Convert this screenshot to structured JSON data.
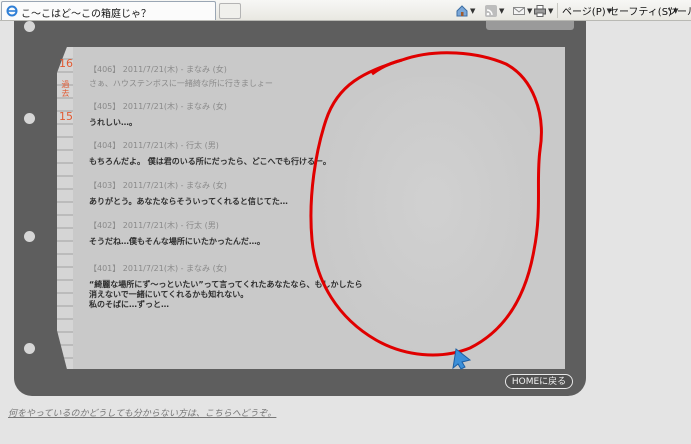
{
  "browser": {
    "tab_title": "こ〜こはど〜この箱庭じゃ？",
    "toolbar": {
      "page_label": "ページ(P)",
      "safety_label": "セーフティ(S)",
      "tools_label": "ツール"
    }
  },
  "side": {
    "num_top": "16",
    "kanji": "過去",
    "num_bottom": "15"
  },
  "entries": [
    {
      "meta": "【406】 2011/7/21(木)  - まなみ (女)",
      "msg": "さぁ、ハウステンボスに一緒綺な所に行きましょー"
    },
    {
      "meta": "【405】 2011/7/21(木)  - まなみ (女)",
      "msg": "うれしい…。"
    },
    {
      "meta": "【404】 2011/7/21(木)  - 行太 (男)",
      "msg": "もちろんだよ。  僕は君のいる所にだったら、どこへでも行けるー。"
    },
    {
      "meta": "【403】 2011/7/21(木)  - まなみ (女)",
      "msg": "ありがとう。あなたならそういってくれると信じてた…"
    },
    {
      "meta": "【402】 2011/7/21(木)  - 行太 (男)",
      "msg": "そうだね…僕もそんな場所にいたかったんだ…。"
    },
    {
      "meta": "【401】 2011/7/21(木)  - まなみ (女)",
      "msg_lines": [
        "“綺麗な場所にず〜っといたい”って言ってくれたあなたなら、もしかしたら",
        "消えないで一緒にいてくれるかも知れない。",
        "私のそばに…ずっと…"
      ]
    }
  ],
  "home_button": "HOMEに戻る",
  "help_link": "何をやっているのかどうしても分からない方は、こちらへどうぞ。",
  "colors": {
    "binder": "#5e5e5e",
    "paper": "#c9c9c9",
    "scribble": "#e00000",
    "accent_orange": "#e15a32",
    "cursor": "#3b8fd9"
  }
}
